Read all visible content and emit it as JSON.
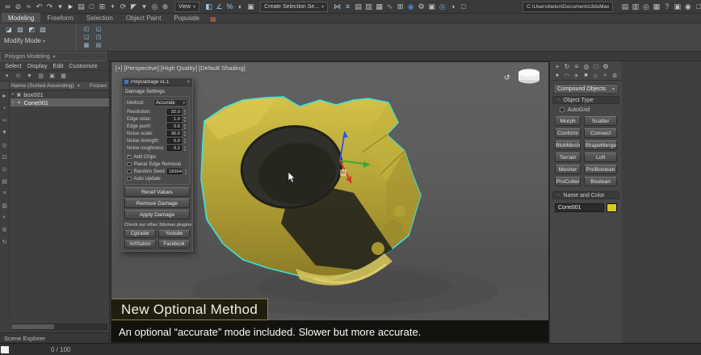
{
  "ui_glyphs": {
    "dropdown": "▾",
    "spinner_up": "▴",
    "spinner_down": "▾",
    "check": "✓",
    "close": "×",
    "sort_asc": "▲",
    "minus": "−",
    "orbit": "↺"
  },
  "colors": {
    "selection_outline": "#3fe3da",
    "object_yellow": "#c7b53d",
    "accent_blue": "#3a78c2",
    "swatch_yellow": "#d8c81f"
  },
  "topbar": {
    "icons_left": [
      {
        "name": "select-and-link-icon",
        "glyph": "∞"
      },
      {
        "name": "unlink-selection-icon",
        "glyph": "⊘"
      },
      {
        "name": "bind-to-spacewarp-icon",
        "glyph": "≈"
      },
      {
        "name": "undo-icon",
        "glyph": "↶"
      },
      {
        "name": "redo-icon",
        "glyph": "↷"
      },
      {
        "name": "selection-filter-icon",
        "glyph": "▾"
      },
      {
        "name": "select-object-icon",
        "glyph": "►",
        "css": "color:#dcdcdc"
      },
      {
        "name": "select-by-name-icon",
        "glyph": "▤"
      },
      {
        "name": "rectangular-selection-icon",
        "glyph": "□"
      },
      {
        "name": "crossing-selection-icon",
        "glyph": "⊞"
      },
      {
        "name": "select-and-move-icon",
        "glyph": "+",
        "css": "color:#e4e4e4"
      },
      {
        "name": "select-and-rotate-icon",
        "glyph": "⟳"
      },
      {
        "name": "select-and-scale-icon",
        "glyph": "◤"
      },
      {
        "name": "reference-coordinate-icon",
        "glyph": "▾"
      },
      {
        "name": "use-pivot-center-icon",
        "glyph": "◎"
      },
      {
        "name": "select-and-manipulate-icon",
        "glyph": "⊕"
      }
    ],
    "view_dropdown": "View",
    "icons_mid": [
      {
        "name": "snap-toggle-icon",
        "glyph": "◧",
        "css": "color:#9ec7e8"
      },
      {
        "name": "angle-snap-icon",
        "glyph": "∠",
        "css": "color:#9ec7e8"
      },
      {
        "name": "percent-snap-icon",
        "glyph": "%",
        "css": "color:#9ec7e8"
      },
      {
        "name": "spinner-snap-icon",
        "glyph": "◐"
      },
      {
        "name": "edit-named-selections-icon",
        "glyph": "▣"
      }
    ],
    "selection_set_dropdown": "Create Selection Se...",
    "icons_right": [
      {
        "name": "mirror-icon",
        "glyph": "⋈",
        "css": "color:#9ec7e8"
      },
      {
        "name": "align-icon",
        "glyph": "≡",
        "css": "color:#9ec7e8"
      },
      {
        "name": "toggle-scene-explorer-icon",
        "glyph": "▤"
      },
      {
        "name": "toggle-layer-explorer-icon",
        "glyph": "▥"
      },
      {
        "name": "toggle-ribbon-icon",
        "glyph": "▦"
      },
      {
        "name": "curve-editor-icon",
        "glyph": "∿",
        "css": "color:#8fba6a"
      },
      {
        "name": "schematic-view-icon",
        "glyph": "⊞"
      },
      {
        "name": "material-editor-icon",
        "glyph": "◉",
        "css": "color:#4a86c8"
      },
      {
        "name": "render-setup-icon",
        "glyph": "⚙",
        "css": "color:#c8c8c8"
      },
      {
        "name": "rendered-frame-icon",
        "glyph": "▣"
      },
      {
        "name": "render-production-icon",
        "glyph": "◎",
        "css": "color:#6fa8dc"
      },
      {
        "name": "render-iterative-icon",
        "glyph": "◑"
      },
      {
        "name": "open-in-viewport-icon",
        "glyph": "□"
      }
    ],
    "project_path": "C:\\Users\\belun\\Documents\\3dsMax",
    "icons_far_right": [
      {
        "name": "workspace-icon",
        "glyph": "▤"
      },
      {
        "name": "layer-manager-icon",
        "glyph": "▥"
      },
      {
        "name": "isolate-toggle-icon",
        "glyph": "◎"
      },
      {
        "name": "display-toggle-icon",
        "glyph": "▦"
      },
      {
        "name": "help-icon",
        "glyph": "?"
      },
      {
        "name": "sign-in-icon",
        "glyph": "▣"
      },
      {
        "name": "notification-icon",
        "glyph": "◉"
      },
      {
        "name": "window-controls-icon",
        "glyph": "□"
      }
    ]
  },
  "ribbon": {
    "tabs": [
      {
        "name": "tab-modeling",
        "label": "Modeling"
      },
      {
        "name": "tab-freeform",
        "label": "Freeform"
      },
      {
        "name": "tab-selection",
        "label": "Selection"
      },
      {
        "name": "tab-object-paint",
        "label": "Object Paint"
      },
      {
        "name": "tab-populate",
        "label": "Populate"
      }
    ],
    "extra_icon": {
      "name": "ribbon-config-icon",
      "glyph": "▦"
    },
    "left_icons": [
      {
        "name": "edit-poly-mode-icon",
        "glyph": "◪"
      },
      {
        "name": "paint-deform-icon",
        "glyph": "▨"
      },
      {
        "name": "freeform-tool-icon",
        "glyph": "◩"
      },
      {
        "name": "selection-tool-icon",
        "glyph": "▧"
      }
    ],
    "modify_mode": "Modify Mode",
    "grid_icons": [
      {
        "name": "subobject-vertex-icon",
        "glyph": "◰"
      },
      {
        "name": "subobject-edge-icon",
        "glyph": "◱"
      },
      {
        "name": "subobject-border-icon",
        "glyph": "◲"
      },
      {
        "name": "subobject-polygon-icon",
        "glyph": "◳"
      },
      {
        "name": "subobject-element-icon",
        "glyph": "▦"
      },
      {
        "name": "subobject-object-icon",
        "glyph": "▤"
      }
    ],
    "polygon_modeling": "Polygon Modeling"
  },
  "scene_explorer": {
    "menu": [
      {
        "name": "menu-select",
        "label": "Select"
      },
      {
        "name": "menu-display",
        "label": "Display"
      },
      {
        "name": "menu-edit",
        "label": "Edit"
      },
      {
        "name": "menu-customize",
        "label": "Customize"
      }
    ],
    "tool_icons": [
      {
        "name": "explorer-mode-icon",
        "glyph": "▾"
      },
      {
        "name": "search-icon",
        "glyph": "⊙"
      },
      {
        "name": "filter-icon",
        "glyph": "▼"
      },
      {
        "name": "column-chooser-icon",
        "glyph": "▥"
      },
      {
        "name": "lock-explorer-icon",
        "glyph": "▣"
      },
      {
        "name": "explorer-settings-icon",
        "glyph": "▦"
      }
    ],
    "columns": {
      "name": "Name (Sorted Ascending)",
      "frozen": "Frozen"
    },
    "rows": [
      {
        "name": "box001",
        "icon": "▣",
        "twisty": "▸"
      },
      {
        "name": "Cone001",
        "icon": "▲",
        "twisty": "▸"
      }
    ],
    "side_icons": [
      {
        "name": "pick-icon",
        "glyph": "►"
      },
      {
        "name": "add-object-icon",
        "glyph": "+"
      },
      {
        "name": "link-icon",
        "glyph": "∞"
      },
      {
        "name": "filter-objects-icon",
        "glyph": "▼"
      },
      {
        "name": "visibility-icon",
        "glyph": "◎"
      },
      {
        "name": "lock-icon",
        "glyph": "⊡"
      },
      {
        "name": "pin-icon",
        "glyph": "⊙"
      },
      {
        "name": "list-view-icon",
        "glyph": "▤"
      },
      {
        "name": "hierarchy-view-icon",
        "glyph": "≡"
      },
      {
        "name": "layer-view-icon",
        "glyph": "▥"
      },
      {
        "name": "material-view-icon",
        "glyph": "◐"
      },
      {
        "name": "explorer-config-icon",
        "glyph": "⚙"
      },
      {
        "name": "refresh-icon",
        "glyph": "↻"
      }
    ],
    "title": "Scene Explorer"
  },
  "viewport": {
    "header": "[+] [Perspective] [High Quality] [Default Shading]"
  },
  "dialog": {
    "title": "PolyDamage v1.1",
    "section_label": "Damage Settings",
    "method_label": "Method:",
    "method_value": "Accurate",
    "spinners": [
      {
        "label": "Resolution:",
        "value": "32.0"
      },
      {
        "label": "Edge relax:",
        "value": "1.0"
      },
      {
        "label": "Edge push:",
        "value": "0.5"
      },
      {
        "label": "Noise scale:",
        "value": "30.0"
      },
      {
        "label": "Noise strength:",
        "value": "5.0"
      },
      {
        "label": "Noise roughness:",
        "value": "0.2"
      }
    ],
    "checkboxes": [
      {
        "label": "Add Chips",
        "checked": true
      },
      {
        "label": "Planar Edge Removal",
        "checked": false
      },
      {
        "label": "Random Seed",
        "checked": false,
        "value": "18364"
      },
      {
        "label": "Auto Update",
        "checked": false
      }
    ],
    "action_buttons": [
      {
        "name": "reset-values-button",
        "label": "Reset Values"
      },
      {
        "name": "remove-damage-button",
        "label": "Remove Damage"
      },
      {
        "name": "apply-damage-button",
        "label": "Apply Damage"
      }
    ],
    "plugins_note": "Check our other 3dsmax plugins:",
    "plugin_buttons": [
      {
        "name": "cgtrader-button",
        "label": "Cgtrader"
      },
      {
        "name": "youtube-button",
        "label": "Youtube"
      },
      {
        "name": "artstation-button",
        "label": "ArtStation"
      },
      {
        "name": "facebook-button",
        "label": "Facebook"
      }
    ]
  },
  "command_panel": {
    "tab_icons": [
      {
        "name": "create-tab-icon",
        "glyph": "+"
      },
      {
        "name": "modify-tab-icon",
        "glyph": "↻"
      },
      {
        "name": "hierarchy-tab-icon",
        "glyph": "≡"
      },
      {
        "name": "motion-tab-icon",
        "glyph": "◎"
      },
      {
        "name": "display-tab-icon",
        "glyph": "□"
      },
      {
        "name": "utilities-tab-icon",
        "glyph": "⚙"
      }
    ],
    "category_icons": [
      {
        "name": "geometry-category-icon",
        "glyph": "●"
      },
      {
        "name": "shapes-category-icon",
        "glyph": "◠"
      },
      {
        "name": "lights-category-icon",
        "glyph": "☀"
      },
      {
        "name": "cameras-category-icon",
        "glyph": "■"
      },
      {
        "name": "helpers-category-icon",
        "glyph": "◇"
      },
      {
        "name": "spacewarps-category-icon",
        "glyph": "≈"
      },
      {
        "name": "systems-category-icon",
        "glyph": "⚙"
      }
    ],
    "category_dropdown": "Compound Objects",
    "object_type_rollout": "Object Type",
    "autogrid_label": "AutoGrid",
    "object_buttons": [
      {
        "name": "morph-button",
        "label": "Morph"
      },
      {
        "name": "scatter-button",
        "label": "Scatter"
      },
      {
        "name": "conform-button",
        "label": "Conform"
      },
      {
        "name": "connect-button",
        "label": "Connect"
      },
      {
        "name": "blobmesh-button",
        "label": "BlobMesh"
      },
      {
        "name": "shapemerge-button",
        "label": "ShapeMerge"
      },
      {
        "name": "terrain-button",
        "label": "Terrain"
      },
      {
        "name": "loft-button",
        "label": "Loft"
      },
      {
        "name": "mesher-button",
        "label": "Mesher"
      },
      {
        "name": "proboolean-button",
        "label": "ProBoolean"
      },
      {
        "name": "procutter-button",
        "label": "ProCutter"
      },
      {
        "name": "boolean-button",
        "label": "Boolean"
      }
    ],
    "name_color_rollout": "Name and Color",
    "object_name": "Cone001"
  },
  "caption": {
    "title": "New Optional Method",
    "subtitle": "An optional “accurate” mode included. Slower but more accurate."
  },
  "status_bar": {
    "counter": "0 / 100"
  }
}
